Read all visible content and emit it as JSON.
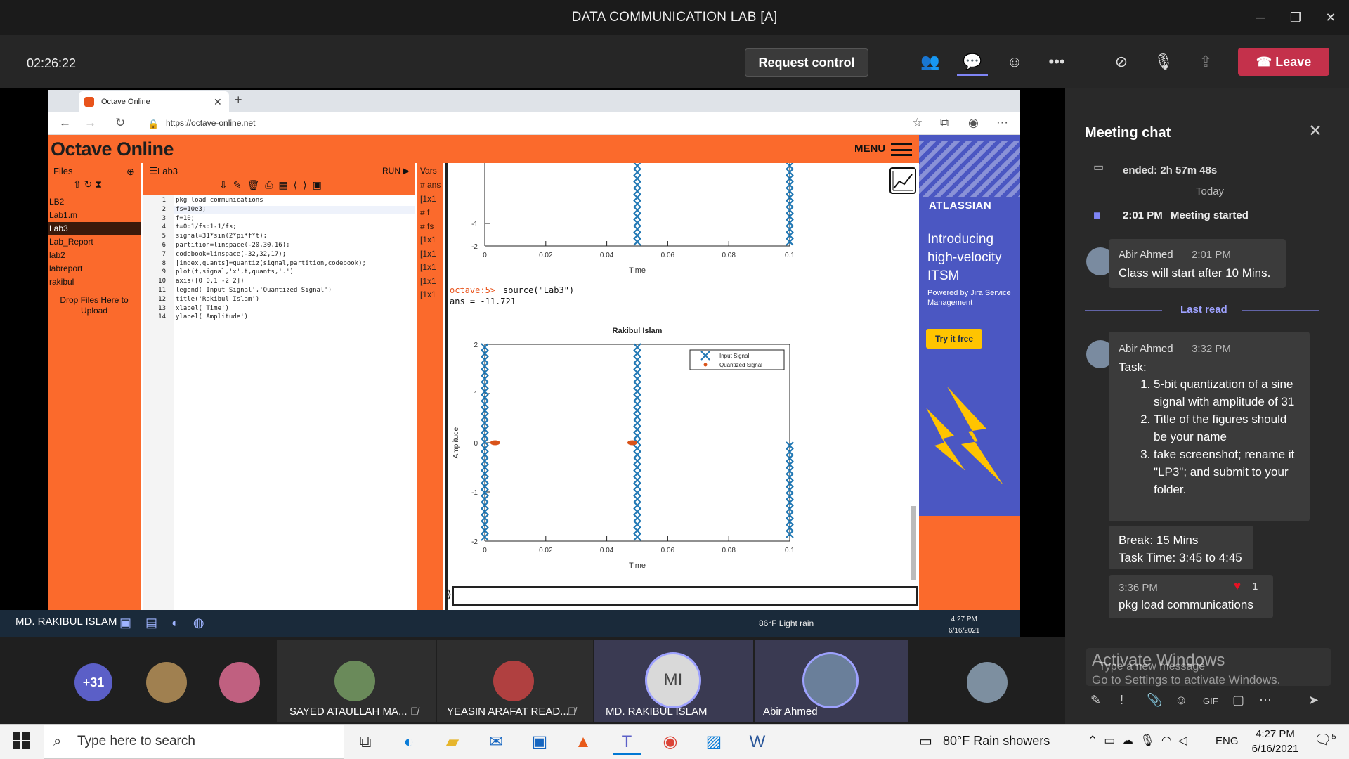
{
  "meeting": {
    "title": "DATA COMMUNICATION LAB [A]",
    "timer": "02:26:22",
    "request_control": "Request control",
    "leave": "Leave"
  },
  "browser": {
    "tab_title": "Octave Online",
    "url": "https://octave-online.net"
  },
  "octave": {
    "logo": "Octave Online",
    "menu": "MENU",
    "files_header": "Files",
    "files": [
      "LB2",
      "Lab1.m",
      "Lab3",
      "Lab_Report",
      "lab2",
      "labreport",
      "rakibul"
    ],
    "selected_file": "Lab3",
    "drop_text": "Drop Files Here to Upload",
    "editor_title": "Lab3",
    "run": "RUN",
    "vars_header": "Vars",
    "vars": [
      "# ans",
      "[1x1",
      "# f",
      "# fs",
      "[1x1",
      "[1x1",
      "[1x1",
      "[1x1",
      "[1x1"
    ],
    "code": [
      "pkg load communications",
      "fs=10e3;",
      "f=10;",
      "t=0:1/fs:1-1/fs;",
      "signal=31*sin(2*pi*f*t);",
      "partition=linspace(-20,30,16);",
      "codebook=linspace(-32,32,17);",
      "[index,quants]=quantiz(signal,partition,codebook);",
      "plot(t,signal,'x',t,quants,'.')",
      "axis([0 0.1 -2 2])",
      "legend('Input Signal','Quantized Signal')",
      "title('Rakibul Islam')",
      "xlabel('Time')",
      "ylabel('Amplitude')"
    ],
    "line_numbers": [
      "1",
      "2",
      "3",
      "4",
      "5",
      "6",
      "7",
      "8",
      "9",
      "10",
      "11",
      "12",
      "13",
      "14"
    ],
    "prompt": "octave:5>",
    "prompt_cmd": "source(\"Lab3\")",
    "ans": "ans = -11.721"
  },
  "chart_data": [
    {
      "type": "scatter",
      "title": "",
      "xlabel": "Time",
      "ylabel": "",
      "xlim": [
        0,
        0.1
      ],
      "ylim": [
        -2,
        2
      ],
      "x_ticks": [
        "0",
        "0.02",
        "0.04",
        "0.06",
        "0.08",
        "0.1"
      ],
      "y_ticks": [
        "-1",
        "-2"
      ],
      "series": [
        {
          "name": "",
          "x": [
            0.05,
            0.1
          ],
          "values": [
            -1.5,
            -1.5
          ],
          "marker": "x",
          "color": "#1f77b4"
        }
      ]
    },
    {
      "type": "scatter",
      "title": "Rakibul Islam",
      "xlabel": "Time",
      "ylabel": "Amplitude",
      "xlim": [
        0,
        0.1
      ],
      "ylim": [
        -2,
        2
      ],
      "x_ticks": [
        "0",
        "0.02",
        "0.04",
        "0.06",
        "0.08",
        "0.1"
      ],
      "y_ticks": [
        "2",
        "1",
        "0",
        "-1",
        "-2"
      ],
      "legend": "top-right",
      "series": [
        {
          "name": "Input Signal",
          "marker": "x",
          "color": "#1f77b4",
          "x": [
            0,
            0.05,
            0.1
          ],
          "values": [
            2,
            2,
            0
          ]
        },
        {
          "name": "Quantized Signal",
          "marker": ".",
          "color": "#d95319",
          "x": [
            0.002,
            0.047
          ],
          "values": [
            0,
            0
          ]
        }
      ]
    }
  ],
  "ad": {
    "brand": "ATLASSIAN",
    "headline": "Introducing high-velocity ITSM",
    "sub": "Powered by Jira Service Management",
    "cta": "Try it free"
  },
  "inner_taskbar": {
    "presenter": "MD. RAKIBUL ISLAM",
    "weather": "86°F  Light rain",
    "time": "4:27 PM",
    "date": "6/16/2021"
  },
  "chat": {
    "title": "Meeting chat",
    "ended_note": "ended: 2h 57m 48s",
    "day_divider": "Today",
    "meeting_started_time": "2:01 PM",
    "meeting_started": "Meeting started",
    "last_read": "Last read",
    "messages": [
      {
        "name": "Abir Ahmed",
        "time": "2:01 PM",
        "text": "Class will start after 10 Mins."
      },
      {
        "name": "Abir Ahmed",
        "time": "3:32 PM",
        "text": "Task:",
        "items": [
          "5-bit quantization of a sine signal with amplitude of 31",
          "Title of the figures should be your name",
          "take screenshot; rename it \"LP3\"; and submit to your folder."
        ]
      },
      {
        "text1": "Break: 15 Mins",
        "text2": "Task Time: 3:45 to 4:45"
      },
      {
        "time": "3:36 PM",
        "reaction_count": "1",
        "text": "pkg load communications"
      }
    ],
    "compose_placeholder": "Type a new message",
    "activate_title": "Activate Windows",
    "activate_sub": "Go to Settings to activate Windows."
  },
  "participants": {
    "overflow": "+31",
    "tiles": [
      {
        "name": "SAYED ATAULLAH MA..."
      },
      {
        "name": "YEASIN ARAFAT READ..."
      },
      {
        "name": "MD. RAKIBUL ISLAM",
        "initials": "MI"
      },
      {
        "name": "Abir Ahmed"
      }
    ]
  },
  "taskbar": {
    "search_placeholder": "Type here to search",
    "weather": "80°F  Rain showers",
    "lang": "ENG",
    "time": "4:27 PM",
    "date": "6/16/2021",
    "notifications": "5"
  }
}
